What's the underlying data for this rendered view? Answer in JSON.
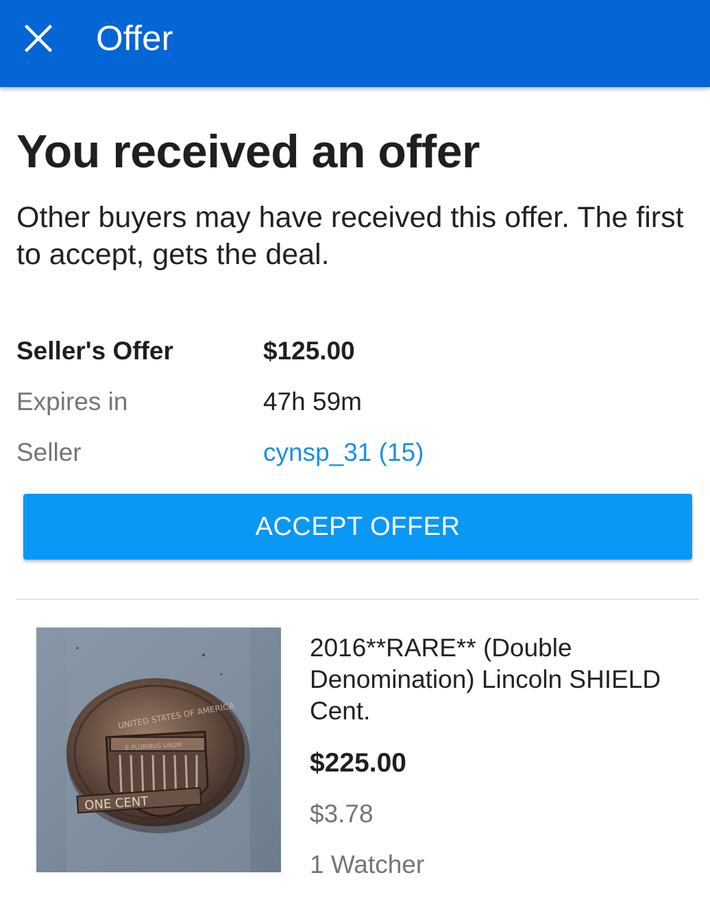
{
  "header": {
    "title": "Offer",
    "close_icon": "close-icon",
    "background_color": "#0465d4"
  },
  "offer": {
    "headline": "You received an offer",
    "description": "Other buyers may have received this offer. The first to accept, gets the deal.",
    "details": {
      "sellers_offer_label": "Seller's Offer",
      "sellers_offer_value": "$125.00",
      "expires_label": "Expires in",
      "expires_value": "47h 59m",
      "seller_label": "Seller",
      "seller_value": "cynsp_31 (15)"
    },
    "accept_button_label": "ACCEPT OFFER",
    "accent_color": "#0b97f5",
    "link_color": "#1a8fe6"
  },
  "item": {
    "title": "2016**RARE** (Double Denomination) Lincoln SHIELD Cent.",
    "price": "$225.00",
    "shipping": "$3.78",
    "watchers": "1 Watcher",
    "image_icon": "coin-photo",
    "coin_inscriptions": [
      "ONE CENT",
      "UNITED STATES OF AMERICA",
      "E PLURIBUS UNUM"
    ]
  }
}
